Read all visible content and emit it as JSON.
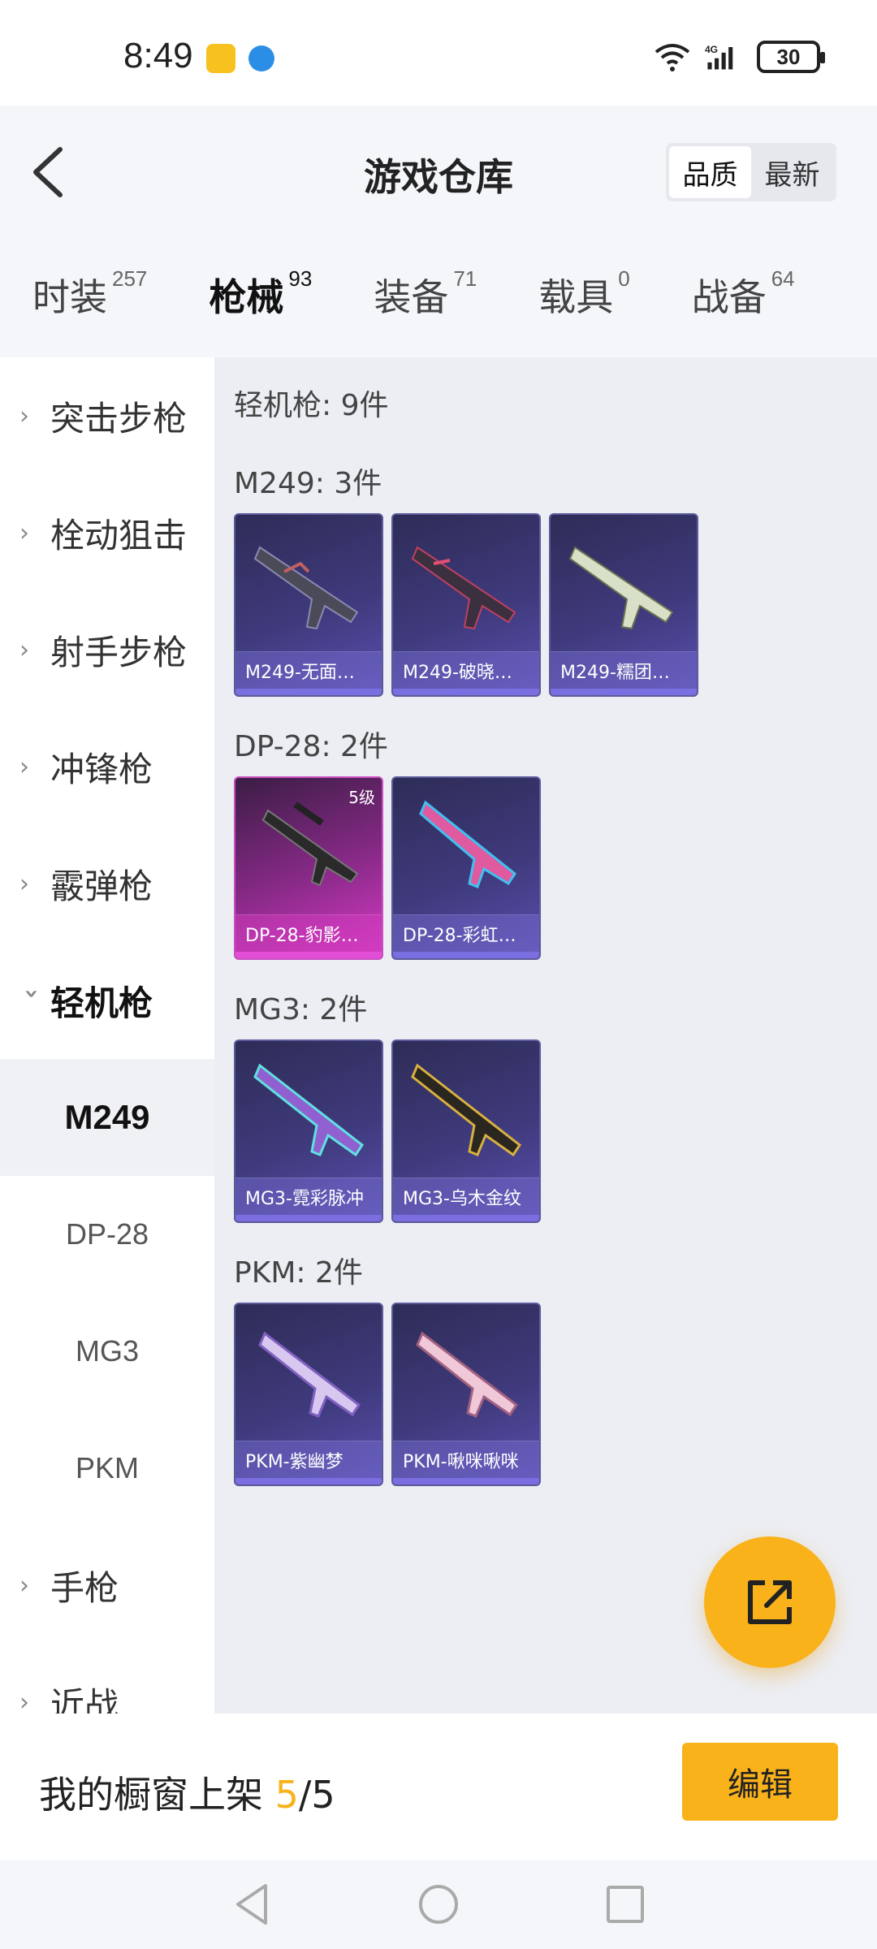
{
  "status_bar": {
    "time": "8:49",
    "battery": "30",
    "network": "4G"
  },
  "header": {
    "title": "游戏仓库",
    "sort_quality": "品质",
    "sort_newest": "最新"
  },
  "tabs": [
    {
      "label": "时装",
      "count": "257"
    },
    {
      "label": "枪械",
      "count": "93"
    },
    {
      "label": "装备",
      "count": "71"
    },
    {
      "label": "载具",
      "count": "0"
    },
    {
      "label": "战备",
      "count": "64"
    }
  ],
  "sidebar": {
    "categories": [
      "突击步枪",
      "栓动狙击",
      "射手步枪",
      "冲锋枪",
      "霰弹枪",
      "轻机枪"
    ],
    "sub_items": [
      "M249",
      "DP-28",
      "MG3",
      "PKM"
    ],
    "after": [
      "手枪",
      "近战"
    ]
  },
  "content": {
    "section_title": "轻机枪: 9件",
    "groups": [
      {
        "title": "M249: 3件",
        "cards": [
          {
            "name": "M249-无面…"
          },
          {
            "name": "M249-破晓…"
          },
          {
            "name": "M249-糯团…"
          }
        ]
      },
      {
        "title": "DP-28: 2件",
        "cards": [
          {
            "name": "DP-28-豹影…",
            "badge": "5级"
          },
          {
            "name": "DP-28-彩虹…"
          }
        ]
      },
      {
        "title": "MG3: 2件",
        "cards": [
          {
            "name": "MG3-霓彩脉冲"
          },
          {
            "name": "MG3-乌木金纹"
          }
        ]
      },
      {
        "title": "PKM: 2件",
        "cards": [
          {
            "name": "PKM-紫幽梦"
          },
          {
            "name": "PKM-啾咪啾咪"
          }
        ]
      }
    ]
  },
  "bottom": {
    "showcase_label": "我的橱窗上架 ",
    "showcase_current": "5",
    "showcase_total": "/5",
    "edit_label": "编辑"
  },
  "colors": {
    "accent": "#f9b21a",
    "card_purple": "#3f3a7c",
    "card_pink": "#d93bc7"
  }
}
